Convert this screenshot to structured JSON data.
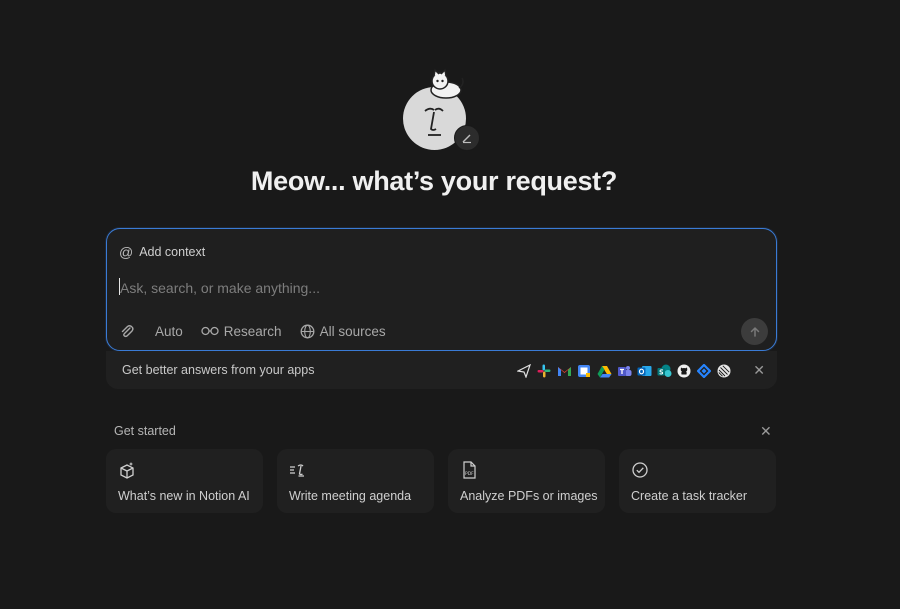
{
  "headline": "Meow... what’s your request?",
  "composer": {
    "context_chip_label": "Add context",
    "input_placeholder": "Ask, search, or make anything...",
    "toolbar": {
      "mode_label": "Auto",
      "research_label": "Research",
      "sources_label": "All sources"
    }
  },
  "apps_strip": {
    "text": "Get better answers from your apps",
    "icons": [
      "send-app-icon",
      "slack-icon",
      "gmail-icon",
      "google-calendar-icon",
      "google-drive-icon",
      "microsoft-teams-icon",
      "outlook-icon",
      "sharepoint-icon",
      "github-icon",
      "jira-icon",
      "linear-icon"
    ]
  },
  "get_started": {
    "title": "Get started",
    "cards": [
      {
        "label": "What’s new in Notion AI",
        "icon": "gift-sparkle-icon"
      },
      {
        "label": "Write meeting agenda",
        "icon": "agenda-icon"
      },
      {
        "label": "Analyze PDFs or images",
        "icon": "pdf-icon"
      },
      {
        "label": "Create a task tracker",
        "icon": "check-circle-icon"
      }
    ]
  },
  "colors": {
    "background": "#191919",
    "accent_border": "#3a7bd5",
    "surface": "#202020"
  }
}
